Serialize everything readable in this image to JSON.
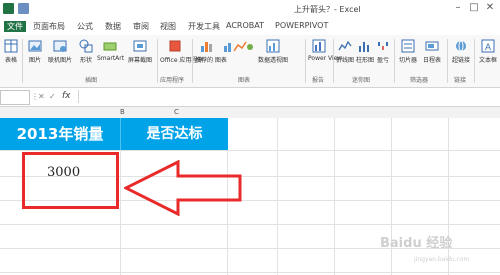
{
  "window": {
    "title": "上升箭头？- Excel",
    "min": "–",
    "max": "□",
    "close": "✕"
  },
  "tabs": [
    {
      "label": "文件"
    },
    {
      "label": "页面布局"
    },
    {
      "label": "公式"
    },
    {
      "label": "数据"
    },
    {
      "label": "审阅"
    },
    {
      "label": "视图"
    },
    {
      "label": "开发工具"
    },
    {
      "label": "ACROBAT"
    },
    {
      "label": "POWERPIVOT"
    }
  ],
  "ribbon": {
    "buttons": [
      {
        "label": "表格"
      },
      {
        "label": "图片"
      },
      {
        "label": "联机图片"
      },
      {
        "label": "形状"
      },
      {
        "label": "SmartArt"
      },
      {
        "label": "屏幕截图"
      },
      {
        "label": "Office 应用程序"
      },
      {
        "label": "推荐的 图表"
      },
      {
        "label": "数据透视图"
      },
      {
        "label": "Power View"
      },
      {
        "label": "折线图"
      },
      {
        "label": "柱形图"
      },
      {
        "label": "盈亏"
      },
      {
        "label": "切片器"
      },
      {
        "label": "日程表"
      },
      {
        "label": "超链接"
      },
      {
        "label": "文本框"
      }
    ],
    "groups": [
      {
        "label": "插图"
      },
      {
        "label": "应用程序"
      },
      {
        "label": "图表"
      },
      {
        "label": "报告"
      },
      {
        "label": "迷你图"
      },
      {
        "label": "筛选器"
      },
      {
        "label": "链接"
      }
    ]
  },
  "formula_bar": {
    "name_box": "",
    "fx": "fx",
    "cancel": "✕",
    "confirm": "✓",
    "value": ""
  },
  "columns": [
    "B",
    "C"
  ],
  "table": {
    "header_b": "2013年销量",
    "header_c": "是否达标",
    "value_b": "3000"
  },
  "colors": {
    "header_fill": "#00a3e8",
    "highlight": "#e82a2a",
    "excel_green": "#217346"
  },
  "watermark": {
    "text": "Baidu 经验",
    "sub": "jingyan.baidu.com"
  }
}
